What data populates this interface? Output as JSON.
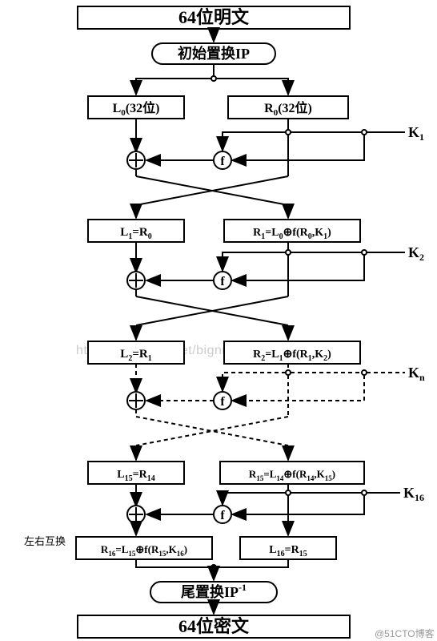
{
  "chart_data": {
    "type": "flowchart",
    "title": "DES加密算法流程图",
    "nodes": [
      {
        "id": "plaintext",
        "label": "64位明文"
      },
      {
        "id": "ip",
        "label": "初始置换IP"
      },
      {
        "id": "l0",
        "label": "L₀(32位)"
      },
      {
        "id": "r0",
        "label": "R₀(32位)"
      },
      {
        "id": "k1",
        "label": "K₁"
      },
      {
        "id": "l1",
        "label": "L₁=R₀"
      },
      {
        "id": "r1",
        "label": "R₁=L₀⊕f(R₀,K₁)"
      },
      {
        "id": "k2",
        "label": "K₂"
      },
      {
        "id": "l2",
        "label": "L₂=R₁"
      },
      {
        "id": "r2",
        "label": "R₂=L₁⊕f(R₁,K₂)"
      },
      {
        "id": "kn",
        "label": "Kₙ"
      },
      {
        "id": "l15",
        "label": "L₁₅=R₁₄"
      },
      {
        "id": "r15",
        "label": "R₁₅=L₁₄⊕f(R₁₄,K₁₅)"
      },
      {
        "id": "k16",
        "label": "K₁₆"
      },
      {
        "id": "r16",
        "label": "R₁₆=L₁₅⊕f(R₁₅,K₁₆)"
      },
      {
        "id": "l16",
        "label": "L₁₆=R₁₅"
      },
      {
        "id": "ipinv",
        "label": "尾置换IP⁻¹"
      },
      {
        "id": "ciphertext",
        "label": "64位密文"
      }
    ],
    "annotations": [
      "左右互换"
    ],
    "operators": [
      "⊕",
      "f"
    ]
  },
  "boxes": {
    "plaintext": "64位明文",
    "ip": "初始置换IP",
    "l0a": "L",
    "l0b": "0",
    "l0c": "(32位)",
    "r0a": "R",
    "r0b": "0",
    "r0c": "(32位)",
    "l1a": "L",
    "l1b": "1",
    "l1c": "=R",
    "l1d": "0",
    "r1a": "R",
    "r1b": "1",
    "r1c": "=L",
    "r1d": "0",
    "r1e": "⊕f(R",
    "r1f": "0",
    "r1g": ",K",
    "r1h": "1",
    "r1i": ")",
    "l2a": "L",
    "l2b": "2",
    "l2c": "=R",
    "l2d": "1",
    "r2a": "R",
    "r2b": "2",
    "r2c": "=L",
    "r2d": "1",
    "r2e": "⊕f(R",
    "r2f": "1",
    "r2g": ",K",
    "r2h": "2",
    "r2i": ")",
    "l15a": "L",
    "l15b": "15",
    "l15c": "=R",
    "l15d": "14",
    "r15a": "R",
    "r15b": "15",
    "r15c": "=L",
    "r15d": "14",
    "r15e": "⊕f(R",
    "r15f": "14",
    "r15g": ",K",
    "r15h": "15",
    "r15i": ")",
    "r16a": "R",
    "r16b": "16",
    "r16c": "=L",
    "r16d": "15",
    "r16e": "⊕f(R",
    "r16f": "15",
    "r16g": ",K",
    "r16h": "16",
    "r16i": ")",
    "l16a": "L",
    "l16b": "16",
    "l16c": "=R",
    "l16d": "15",
    "ipinv_a": "尾置换IP",
    "ipinv_b": "-1",
    "ciphertext": "64位密文"
  },
  "labels": {
    "k1a": "K",
    "k1b": "1",
    "k2a": "K",
    "k2b": "2",
    "kna": "K",
    "knb": "n",
    "k16a": "K",
    "k16b": "16",
    "swap": "左右互换",
    "op_xor": "+",
    "op_f": "f"
  },
  "watermark": {
    "url": "http://blog.csdn.net/bignng cquitsong",
    "blog": "@51CTO博客"
  }
}
